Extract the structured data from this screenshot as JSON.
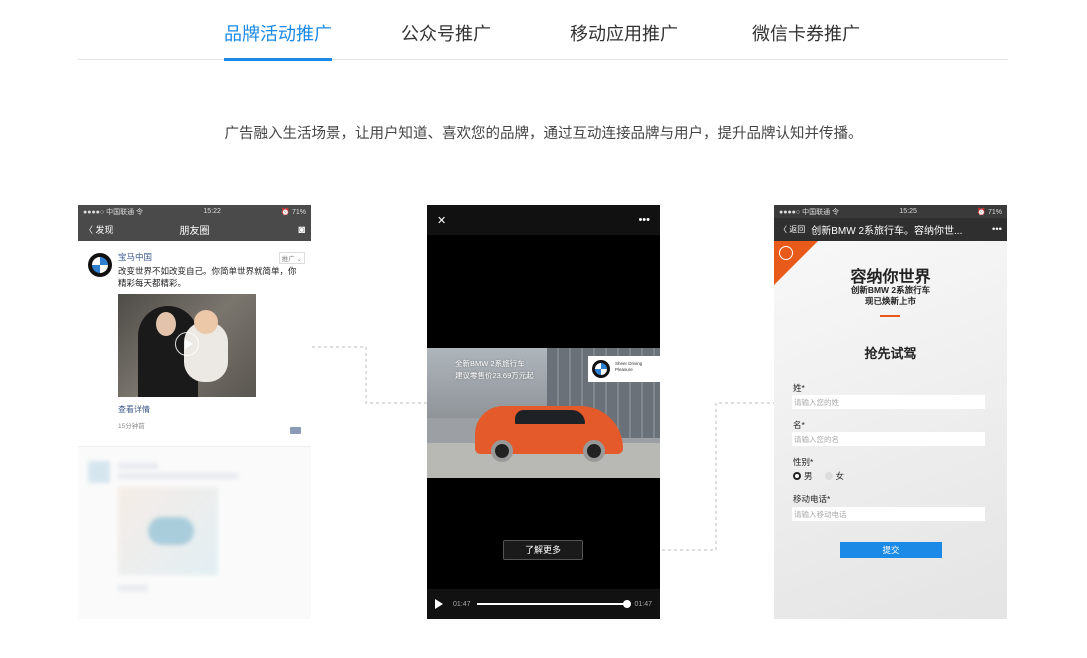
{
  "tabs": [
    {
      "label": "品牌活动推广",
      "active": true
    },
    {
      "label": "公众号推广",
      "active": false
    },
    {
      "label": "移动应用推广",
      "active": false
    },
    {
      "label": "微信卡券推广",
      "active": false
    }
  ],
  "description": "广告融入生活场景，让用户知道、喜欢您的品牌，通过互动连接品牌与用户，提升品牌认知并传播。",
  "moments_phone": {
    "carrier": "●●●●○ 中国联通 令",
    "time": "15:22",
    "battery": "⏰ 71%",
    "back_label": "〈 发现",
    "title": "朋友圈",
    "camera_icon": "camera-icon",
    "post": {
      "author": "宝马中国",
      "ad_tag": "推广 ⌄",
      "text": "改变世界不如改变自己。你简单世界就简单，你精彩每天都精彩。",
      "link": "查看详情",
      "time": "15分钟前"
    }
  },
  "video_phone": {
    "close": "✕",
    "more": "•••",
    "ad_text_line1": "全新BMW 2系旅行车",
    "ad_text_line2": "建议零售价23.69万元起",
    "logo_text": "Sheer Driving Pleasure",
    "learn_more": "了解更多",
    "time_current": "01:47",
    "time_total": "01:47"
  },
  "form_phone": {
    "carrier": "●●●●○ 中国联通 令",
    "time": "15:25",
    "battery": "⏰ 71%",
    "back_label": "〈 返回",
    "title": "创新BMW 2系旅行车。容纳你世...",
    "more": "•••",
    "headline": "容纳你世界",
    "sub1": "创新BMW 2系旅行车",
    "sub2": "现已焕新上市",
    "form_heading": "抢先试驾",
    "fields": {
      "surname_label": "姓*",
      "surname_placeholder": "请输入您的姓",
      "name_label": "名*",
      "name_placeholder": "请输入您的名",
      "gender_label": "性别*",
      "male": "男",
      "female": "女",
      "phone_label": "移动电话*",
      "phone_placeholder": "请输入移动电话"
    },
    "submit": "提交"
  },
  "colors": {
    "accent": "#1a8ae6",
    "brand_orange": "#e85a1a"
  }
}
